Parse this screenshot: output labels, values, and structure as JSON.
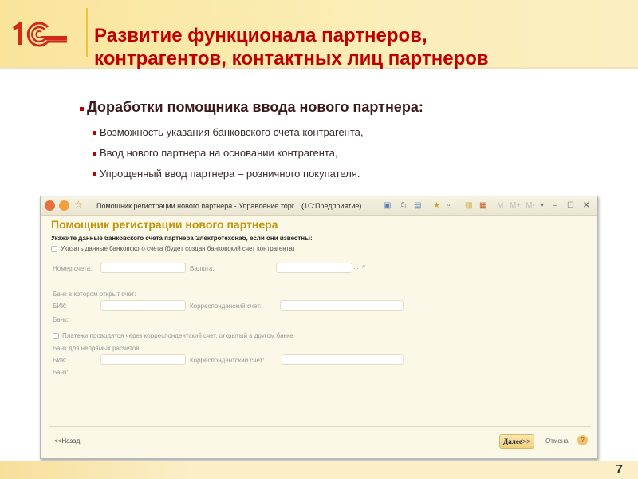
{
  "slide": {
    "logo_text": "1С",
    "title_line1": "Развитие функционала партнеров,",
    "title_line2": "контрагентов, контактных лиц партнеров",
    "heading": "Доработки помощника ввода нового партнера:",
    "bullets": [
      "Возможность указания банковского счета контрагента,",
      "Ввод нового партнера на основании контрагента,",
      "Упрощенный ввод партнера – розничного покупателя."
    ],
    "page_number": "7"
  },
  "window": {
    "title": "Помощник регистрации нового партнера - Управление торг... (1С:Предприятие)",
    "toolbar": {
      "m": "M",
      "mplus": "M+",
      "mminus": "M-"
    },
    "form_title": "Помощник регистрации нового партнера",
    "instruction": "Укажите данные банковского счета партнера Электротехснаб, если они известны:",
    "checkbox_bank": "Указать данные банковского счета (будет создан банковский счет контрагента)",
    "account_label": "Номер счета:",
    "currency_label": "Валюта:",
    "currency_more": "...",
    "bank_section": "Банк в котором открыт счет:",
    "bik_label": "БИК:",
    "corr_label": "Корреспонденский счет:",
    "bank_label": "Банк:",
    "checkbox_indirect": "Платежи проводятся через корреспондентский счет, открытый в другом банке",
    "indirect_section": "Банк для непрямых расчетов:",
    "bik2_label": "БИК:",
    "corr2_label": "Корреспондентский счет:",
    "bank2_label": "Банк:",
    "back": "<<Назад",
    "next": "Далее>>",
    "cancel": "Отмена",
    "help": "?"
  }
}
